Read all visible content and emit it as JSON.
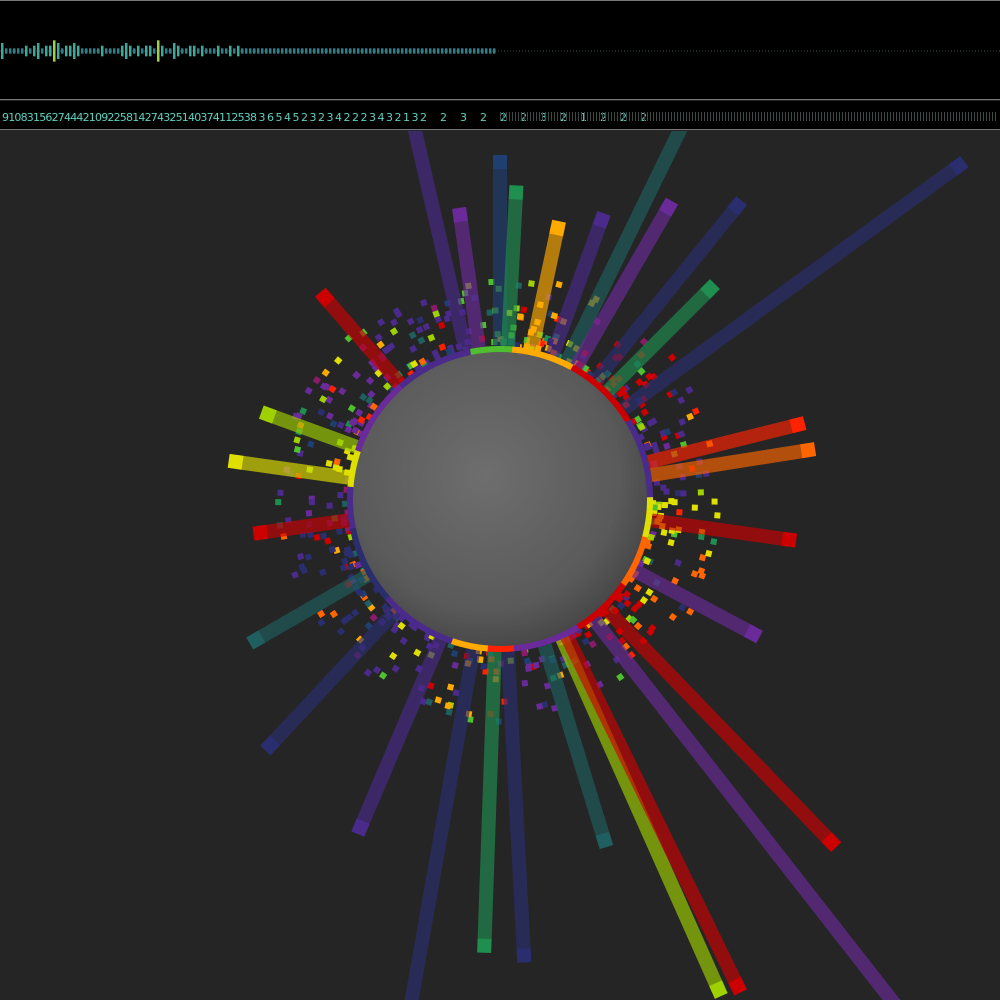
{
  "histogram": {
    "values": [
      3,
      1,
      1,
      1,
      1,
      1,
      2,
      1,
      2,
      3,
      1,
      2,
      2,
      4,
      3,
      1,
      2,
      2,
      3,
      2,
      1,
      1,
      1,
      1,
      1,
      2,
      1,
      1,
      1,
      1,
      2,
      3,
      2,
      1,
      2,
      1,
      2,
      2,
      1,
      4,
      2,
      1,
      1,
      3,
      2,
      1,
      1,
      2,
      2,
      1,
      2,
      1,
      1,
      1,
      2,
      1,
      1,
      2,
      1,
      2,
      1,
      1,
      1,
      1,
      1,
      1,
      1,
      1,
      1,
      1,
      1,
      1,
      1,
      1,
      1,
      1,
      1,
      1,
      1,
      1,
      1,
      1,
      1,
      1,
      1,
      1,
      1,
      1,
      1,
      1,
      1,
      1,
      1,
      1,
      1,
      1,
      1,
      1,
      1,
      1,
      1,
      1,
      1,
      1,
      1,
      1,
      1,
      1,
      1,
      1,
      1,
      1,
      1,
      1,
      1,
      1,
      1,
      1,
      1,
      1,
      1,
      1,
      1,
      1
    ],
    "max": 6,
    "accent_colors": [
      "#3fa898",
      "#9ad24a",
      "#2f7f88"
    ]
  },
  "counts": {
    "labels": [
      "9",
      "1",
      "0",
      "8",
      "3",
      "1",
      "5",
      "6",
      "2",
      "7",
      "4",
      "4",
      "4",
      "2",
      "1",
      "0",
      "9",
      "2",
      "2",
      "5",
      "8",
      "1",
      "4",
      "2",
      "7",
      "4",
      "3",
      "2",
      "5",
      "1",
      "4",
      "0",
      "3",
      "7",
      "4",
      "1",
      "1",
      "2",
      "5",
      "3",
      "8",
      "3",
      "6",
      "5",
      "4",
      "5",
      "2",
      "3",
      "2",
      "3",
      "4",
      "2",
      "2",
      "2",
      "3",
      "4",
      "3",
      "2",
      "1",
      "3",
      "2",
      "2",
      "3",
      "2",
      "2",
      "2",
      "3",
      "2",
      "1",
      "2",
      "2",
      "2"
    ],
    "color": "#5fd0c0",
    "filler_color": "#3c4a48"
  },
  "viz": {
    "center": "#606060",
    "palette": [
      "#2a2e6e",
      "#4a2a8a",
      "#6a2a9a",
      "#8a1a6a",
      "#cc0000",
      "#ff2200",
      "#ff6600",
      "#ffaa00",
      "#e0e000",
      "#9fd000",
      "#4fbf30",
      "#1f8f50",
      "#1f5f60",
      "#1f3f70"
    ]
  }
}
